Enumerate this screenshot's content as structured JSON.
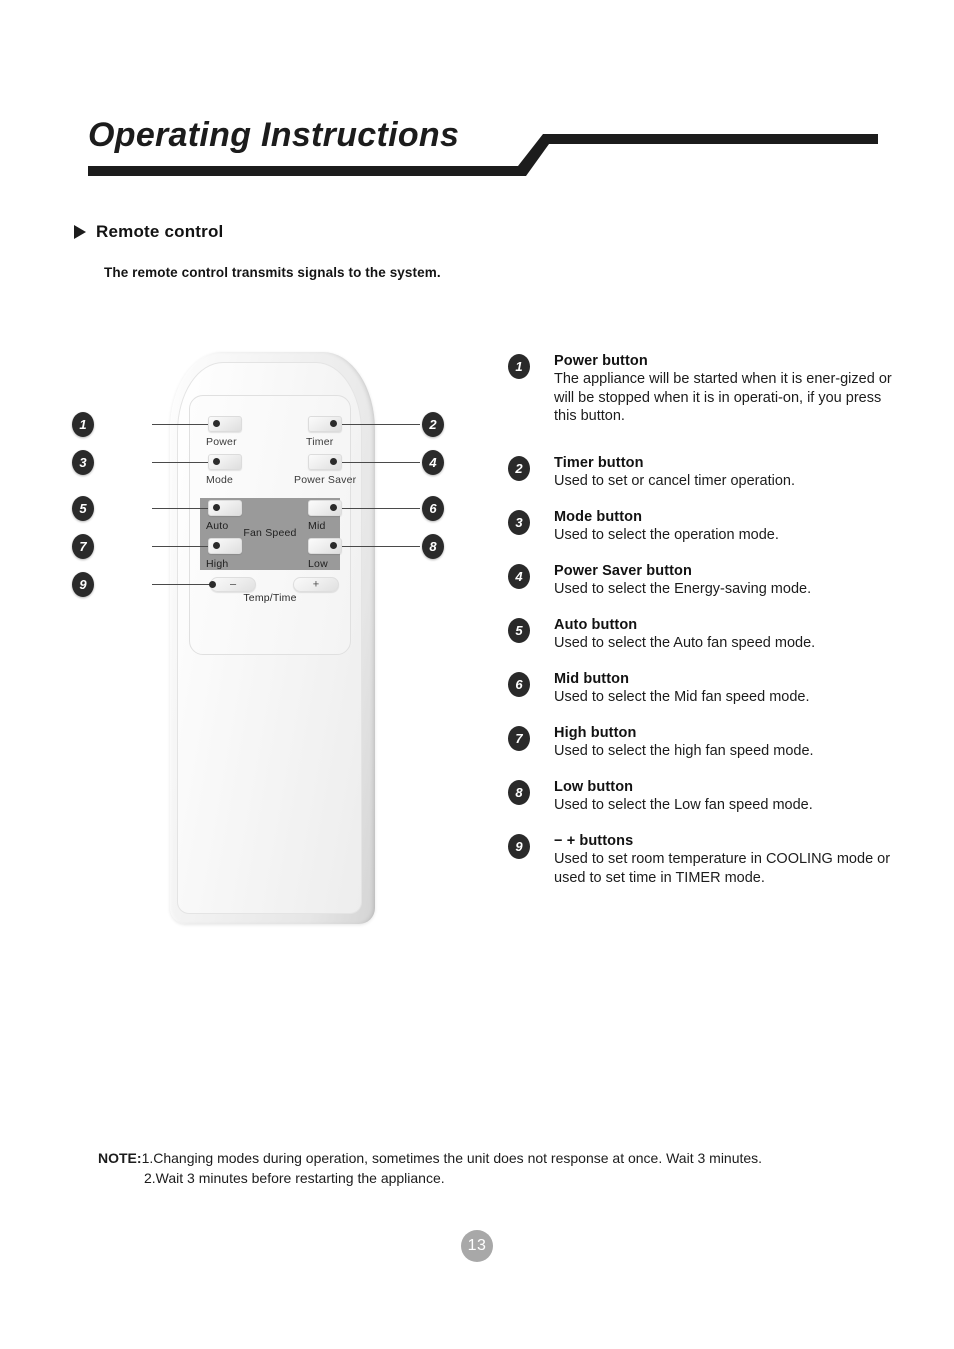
{
  "header": {
    "title": "Operating Instructions"
  },
  "section": {
    "heading": "Remote control",
    "intro": "The remote control transmits signals  to the system."
  },
  "remote": {
    "keys": [
      {
        "id": "power",
        "label": "Power"
      },
      {
        "id": "timer",
        "label": "Timer"
      },
      {
        "id": "mode",
        "label": "Mode"
      },
      {
        "id": "power-saver",
        "label": "Power Saver"
      },
      {
        "id": "auto",
        "label": "Auto"
      },
      {
        "id": "mid",
        "label": "Mid"
      },
      {
        "id": "high",
        "label": "High"
      },
      {
        "id": "low",
        "label": "Low"
      }
    ],
    "fan_speed_caption": "Fan Speed",
    "temp_time_caption": "Temp/Time",
    "minus_sign": "–",
    "plus_sign": "+",
    "callouts": [
      "1",
      "2",
      "3",
      "4",
      "5",
      "6",
      "7",
      "8",
      "9"
    ],
    "panel_color": "#9a9a9a",
    "body_color": "#f1f1f1"
  },
  "legend": {
    "items": [
      {
        "num": "1",
        "title": "Power button",
        "desc": "The appliance will be started when it is ener-gized or will be stopped when it is in operati-on, if you press this button."
      },
      {
        "num": "2",
        "title": "Timer button",
        "desc": "Used to set or cancel timer operation."
      },
      {
        "num": "3",
        "title": "Mode button",
        "desc": "Used to select the operation mode."
      },
      {
        "num": "4",
        "title": "Power Saver button",
        "desc": "Used to select the Energy-saving mode."
      },
      {
        "num": "5",
        "title": "Auto button",
        "desc": "Used to select the Auto fan speed  mode."
      },
      {
        "num": "6",
        "title": "Mid   button",
        "desc": "Used to select the Mid fan speed  mode."
      },
      {
        "num": "7",
        "title": "High button",
        "desc": "Used to select the high fan speed  mode."
      },
      {
        "num": "8",
        "title": "Low  button",
        "desc": "Used to select the Low fan speed mode."
      },
      {
        "num": "9",
        "title": "− +  buttons",
        "desc": "Used to set room temperature in COOLING mode or used to set time in TIMER mode."
      }
    ]
  },
  "note": {
    "label": "NOTE:",
    "line1": "1.Changing modes during operation, sometimes the unit does not response at once. Wait 3 minutes.",
    "line2": "2.Wait 3 minutes before restarting the appliance."
  },
  "footer": {
    "page_number": "13"
  }
}
